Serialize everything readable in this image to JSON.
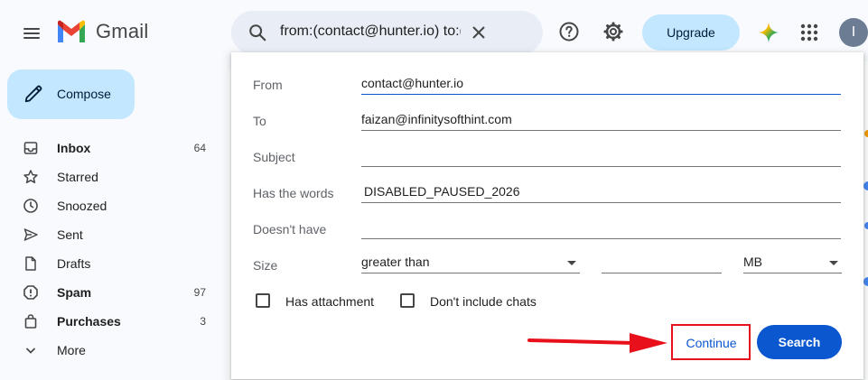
{
  "header": {
    "app_name": "Gmail",
    "search_query": "from:(contact@hunter.io) to:(faizan@infinitysofthint.com)",
    "upgrade_label": "Upgrade",
    "avatar_initial": "I"
  },
  "sidebar": {
    "compose_label": "Compose",
    "items": [
      {
        "label": "Inbox",
        "count": "64",
        "icon": "inbox-icon",
        "bold": true
      },
      {
        "label": "Starred",
        "count": "",
        "icon": "star-icon",
        "bold": false
      },
      {
        "label": "Snoozed",
        "count": "",
        "icon": "clock-icon",
        "bold": false
      },
      {
        "label": "Sent",
        "count": "",
        "icon": "send-icon",
        "bold": false
      },
      {
        "label": "Drafts",
        "count": "",
        "icon": "draft-icon",
        "bold": false
      },
      {
        "label": "Spam",
        "count": "97",
        "icon": "spam-icon",
        "bold": true
      },
      {
        "label": "Purchases",
        "count": "3",
        "icon": "shopping-bag-icon",
        "bold": true
      },
      {
        "label": "More",
        "count": "",
        "icon": "chevron-down-icon",
        "bold": false
      }
    ]
  },
  "advanced_search": {
    "from": {
      "label": "From",
      "value": "contact@hunter.io"
    },
    "to": {
      "label": "To",
      "value": "faizan@infinitysofthint.com"
    },
    "subject": {
      "label": "Subject",
      "value": ""
    },
    "has_words": {
      "label": "Has the words",
      "value": "DISABLED_PAUSED_2026"
    },
    "doesnt_have": {
      "label": "Doesn't have",
      "value": ""
    },
    "size": {
      "label": "Size",
      "comparator": "greater than",
      "value": "",
      "unit": "MB"
    },
    "has_attachment_label": "Has attachment",
    "exclude_chats_label": "Don't include chats",
    "continue_label": "Continue",
    "search_label": "Search"
  },
  "colors": {
    "accent": "#0b57d0",
    "compose_bg": "#c2e7ff",
    "annotation_red": "#e8111b"
  }
}
